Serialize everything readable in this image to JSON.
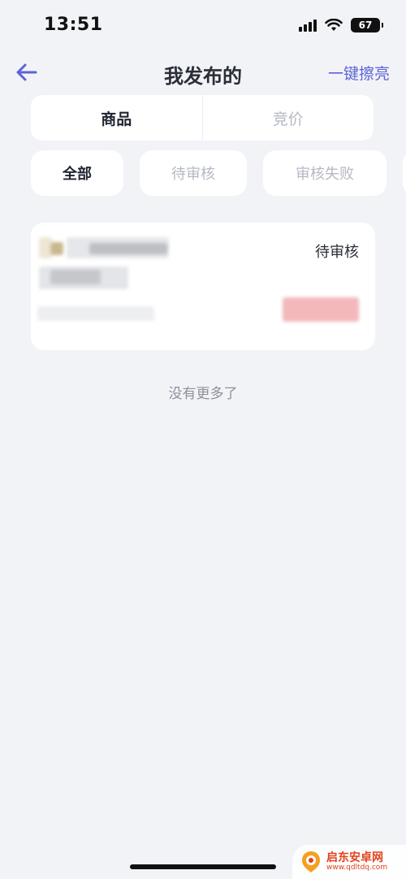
{
  "status_bar": {
    "time": "13:51",
    "battery": "67"
  },
  "nav": {
    "title": "我发布的",
    "action": "一键擦亮"
  },
  "segment_tabs": [
    {
      "label": "商品",
      "active": true
    },
    {
      "label": "竞价",
      "active": false
    }
  ],
  "filter_chips": [
    {
      "label": "全部",
      "active": true
    },
    {
      "label": "待审核",
      "active": false
    },
    {
      "label": "审核失败",
      "active": false
    }
  ],
  "items": [
    {
      "status": "待审核"
    }
  ],
  "list_footer": "没有更多了",
  "watermark": {
    "name": "启东安卓网",
    "url": "www.qdltdq.com"
  },
  "colors": {
    "accent": "#5B64D6",
    "background": "#F2F3F7",
    "card": "#FFFFFF",
    "price_blur": "#F2B8BA"
  }
}
